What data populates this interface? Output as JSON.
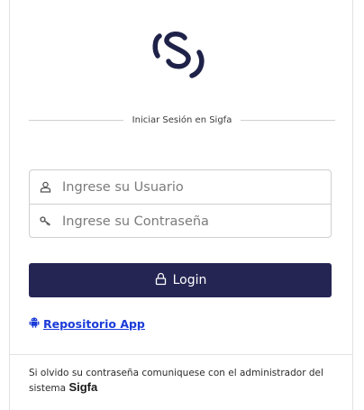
{
  "login_form": {
    "heading": "Iniciar Sesión en Sigfa",
    "username": {
      "value": "",
      "placeholder": "Ingrese su Usuario",
      "icon": "user-icon"
    },
    "password": {
      "value": "",
      "placeholder": "Ingrese su Contraseña",
      "icon": "key-icon"
    },
    "login_button": {
      "label": "Login",
      "icon": "lock-icon"
    },
    "repository_link": {
      "label": "Repositorio App",
      "icon": "android-icon"
    }
  },
  "footer": {
    "message": "Si olvido su contraseña comuniquese con el administrador del sistema",
    "brand": "Sigfa"
  },
  "colors": {
    "primary": "#242553",
    "link": "#1a3bd8",
    "border": "#cfcfcf"
  }
}
